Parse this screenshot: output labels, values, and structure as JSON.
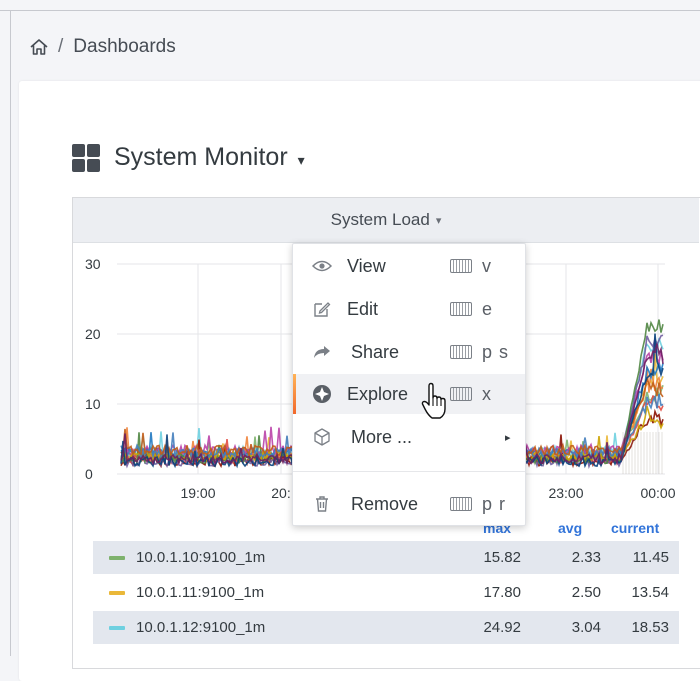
{
  "breadcrumb": {
    "home_icon": "home-icon",
    "separator": "/",
    "current": "Dashboards"
  },
  "dashboard": {
    "title": "System Monitor",
    "title_caret": "▾",
    "icon": "dashboard-grid-icon"
  },
  "panel": {
    "title": "System Load",
    "title_caret": "▾",
    "menu": {
      "items": [
        {
          "label": "View",
          "shortcut": "v",
          "icon": "eye-icon"
        },
        {
          "label": "Edit",
          "shortcut": "e",
          "icon": "edit-icon"
        },
        {
          "label": "Share",
          "shortcut": "p s",
          "icon": "share-icon"
        },
        {
          "label": "Explore",
          "shortcut": "x",
          "icon": "compass-icon",
          "active": true
        },
        {
          "label": "More ...",
          "icon": "cube-icon",
          "submenu": "▸"
        },
        {
          "label": "Remove",
          "shortcut": "p r",
          "icon": "trash-icon"
        }
      ]
    }
  },
  "chart_data": {
    "type": "line",
    "title": "System Load",
    "y_ticks": [
      "0",
      "10",
      "20",
      "30"
    ],
    "ylim": [
      0,
      30
    ],
    "x_ticks": [
      "19:00",
      "20:",
      "23:00",
      "00:00"
    ],
    "series": [
      {
        "name": "10.0.1.10:9100_1m",
        "color": "#7eb26d",
        "values": [
          2,
          3,
          2.5,
          2.2,
          2.8,
          2.3,
          2.1,
          2.4,
          2.6,
          11.45
        ]
      },
      {
        "name": "10.0.1.11:9100_1m",
        "color": "#eab839",
        "values": [
          2.4,
          2.9,
          2.6,
          2.5,
          3,
          2.6,
          2.4,
          2.5,
          2.7,
          13.54
        ]
      },
      {
        "name": "10.0.1.12:9100_1m",
        "color": "#6ed0e0",
        "values": [
          3,
          3.6,
          3.1,
          3.2,
          3.5,
          3,
          2.9,
          3.1,
          3.3,
          18.53
        ]
      }
    ],
    "grid": true
  },
  "legend": {
    "headers": {
      "max": "max",
      "avg": "avg",
      "current": "current"
    },
    "rows": [
      {
        "name": "10.0.1.10:9100_1m",
        "color": "#7eb26d",
        "max": "15.82",
        "avg": "2.33",
        "current": "11.45"
      },
      {
        "name": "10.0.1.11:9100_1m",
        "color": "#eab839",
        "max": "17.80",
        "avg": "2.50",
        "current": "13.54"
      },
      {
        "name": "10.0.1.12:9100_1m",
        "color": "#6ed0e0",
        "max": "24.92",
        "avg": "3.04",
        "current": "18.53"
      }
    ]
  }
}
